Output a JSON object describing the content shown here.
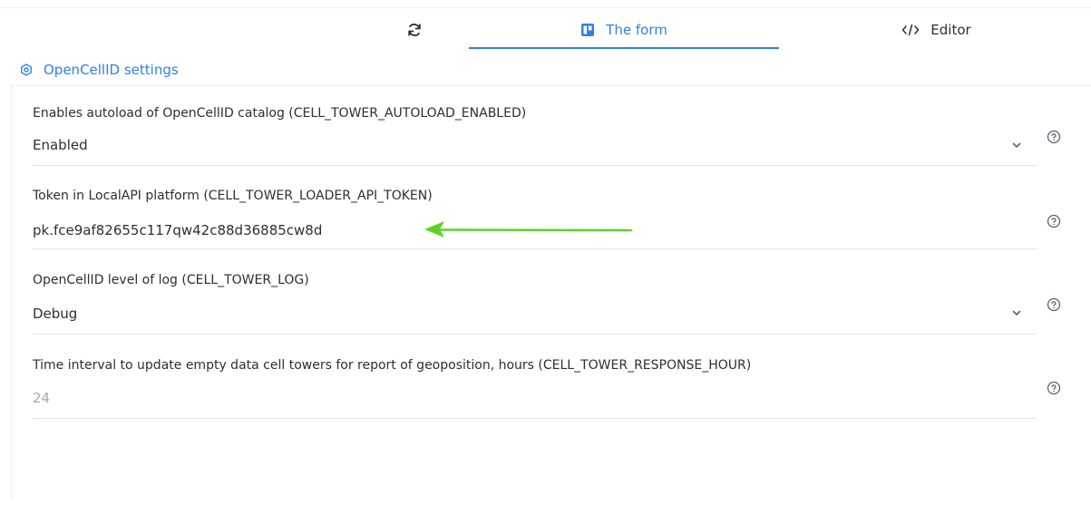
{
  "tabs": {
    "refresh_icon": "refresh-icon",
    "form_label": "The form",
    "form_icon": "board-icon",
    "editor_label": "Editor",
    "editor_icon": "code-icon",
    "active_color": "#2f80ed"
  },
  "section": {
    "title": "OpenCellID settings",
    "icon": "settings-gear-icon"
  },
  "fields": [
    {
      "label": "Enables autoload of OpenCellID catalog (CELL_TOWER_AUTOLOAD_ENABLED)",
      "value": "Enabled",
      "type": "select"
    },
    {
      "label": "Token in LocalAPI platform (CELL_TOWER_LOADER_API_TOKEN)",
      "value": "pk.fce9af82655c117qw42c88d36885cw8d",
      "type": "text"
    },
    {
      "label": "OpenCellID level of log (CELL_TOWER_LOG)",
      "value": "Debug",
      "type": "select"
    },
    {
      "label": "Time interval to update empty data cell towers for report of geoposition, hours (CELL_TOWER_RESPONSE_HOUR)",
      "placeholder": "24",
      "type": "number"
    }
  ],
  "annotation": {
    "arrow_color": "#5fd02a"
  }
}
